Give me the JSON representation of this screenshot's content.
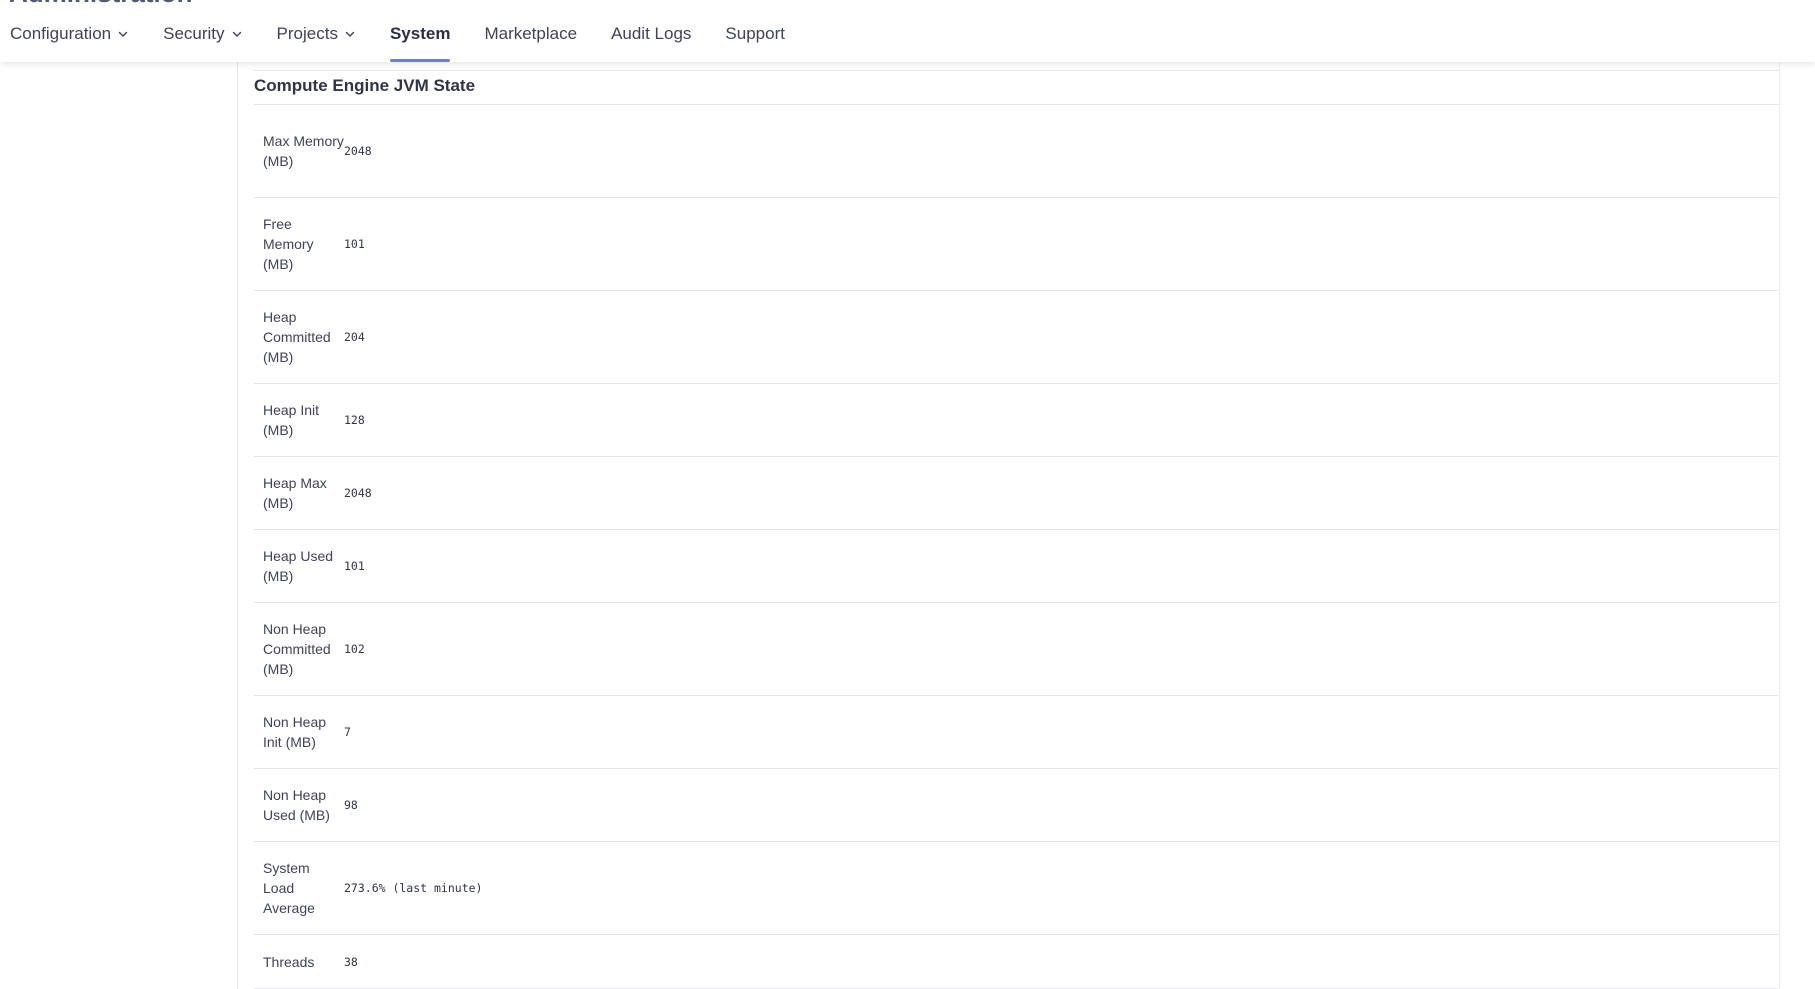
{
  "header": {
    "title": "Administration",
    "nav": [
      {
        "label": "Configuration",
        "has_dropdown": true,
        "active": false
      },
      {
        "label": "Security",
        "has_dropdown": true,
        "active": false
      },
      {
        "label": "Projects",
        "has_dropdown": true,
        "active": false
      },
      {
        "label": "System",
        "has_dropdown": false,
        "active": true
      },
      {
        "label": "Marketplace",
        "has_dropdown": false,
        "active": false
      },
      {
        "label": "Audit Logs",
        "has_dropdown": false,
        "active": false
      },
      {
        "label": "Support",
        "has_dropdown": false,
        "active": false
      }
    ]
  },
  "section": {
    "title": "Compute Engine JVM State",
    "rows": [
      {
        "label": "Max Memory (MB)",
        "value": "2048"
      },
      {
        "label": "Free Memory (MB)",
        "value": "101"
      },
      {
        "label": "Heap Committed (MB)",
        "value": "204"
      },
      {
        "label": "Heap Init (MB)",
        "value": "128"
      },
      {
        "label": "Heap Max (MB)",
        "value": "2048"
      },
      {
        "label": "Heap Used (MB)",
        "value": "101"
      },
      {
        "label": "Non Heap Committed (MB)",
        "value": "102"
      },
      {
        "label": "Non Heap Init (MB)",
        "value": "7"
      },
      {
        "label": "Non Heap Used (MB)",
        "value": "98"
      },
      {
        "label": "System Load Average",
        "value": "273.6% (last minute)"
      },
      {
        "label": "Threads",
        "value": "38"
      }
    ]
  },
  "colors": {
    "accent": "#6f7fd0",
    "text": "#3e4357",
    "divider": "#e3e5eb"
  }
}
